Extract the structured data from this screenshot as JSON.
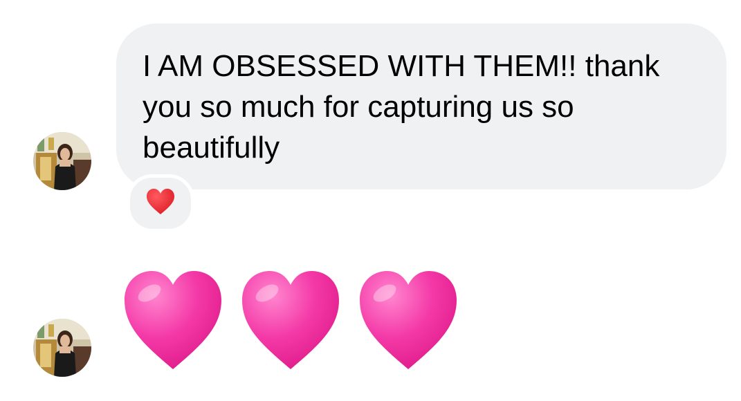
{
  "messages": [
    {
      "kind": "text",
      "text": "I AM OBSESSED WITH THEM!! thank you so much for capturing us so beautifully",
      "reaction": "red-heart"
    },
    {
      "kind": "emoji",
      "emoji": [
        "pink-heart",
        "pink-heart",
        "pink-heart"
      ]
    }
  ],
  "colors": {
    "bubble_bg": "#f0f1f3",
    "text": "#000000",
    "reaction_heart": "#e8202a",
    "pink_heart": "#f0209c"
  }
}
